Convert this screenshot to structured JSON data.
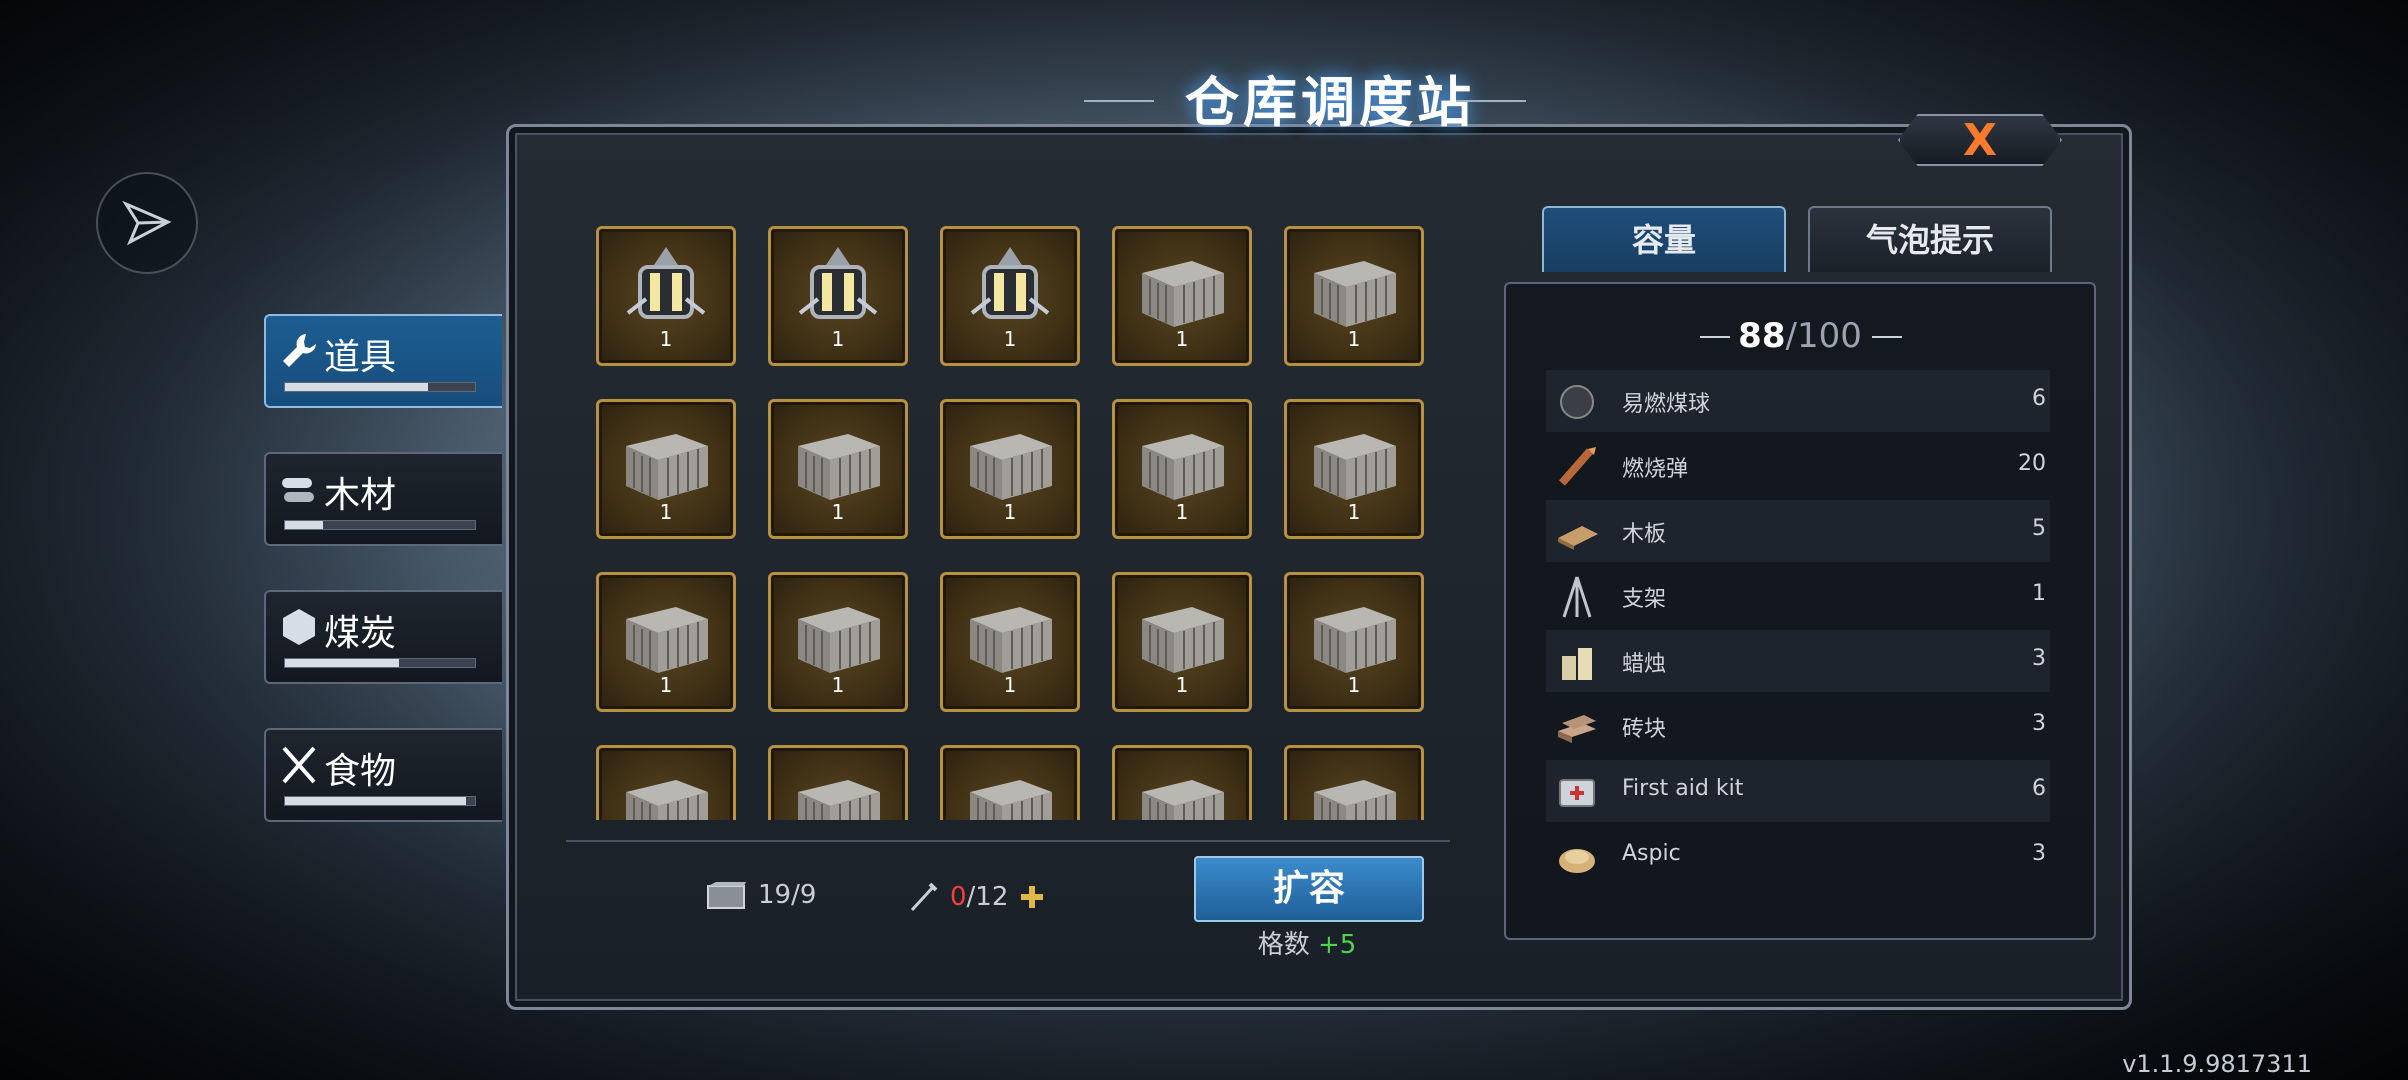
{
  "title": "仓库调度站",
  "close_label": "X",
  "sidebar": {
    "items": [
      {
        "label": "道具",
        "icon": "wrench-icon",
        "progress": 0.75,
        "active": true
      },
      {
        "label": "木材",
        "icon": "logs-icon",
        "progress": 0.2,
        "active": false
      },
      {
        "label": "煤炭",
        "icon": "coal-icon",
        "progress": 0.6,
        "active": false
      },
      {
        "label": "食物",
        "icon": "utensils-icon",
        "progress": 0.95,
        "active": false
      }
    ]
  },
  "grid": {
    "slots": [
      {
        "type": "lantern",
        "qty": "1"
      },
      {
        "type": "lantern",
        "qty": "1"
      },
      {
        "type": "lantern",
        "qty": "1"
      },
      {
        "type": "crate",
        "qty": "1"
      },
      {
        "type": "crate",
        "qty": "1"
      },
      {
        "type": "crate",
        "qty": "1"
      },
      {
        "type": "crate",
        "qty": "1"
      },
      {
        "type": "crate",
        "qty": "1"
      },
      {
        "type": "crate",
        "qty": "1"
      },
      {
        "type": "crate",
        "qty": "1"
      },
      {
        "type": "crate",
        "qty": "1"
      },
      {
        "type": "crate",
        "qty": "1"
      },
      {
        "type": "crate",
        "qty": "1"
      },
      {
        "type": "crate",
        "qty": "1"
      },
      {
        "type": "crate",
        "qty": "1"
      },
      {
        "type": "crate",
        "qty": ""
      },
      {
        "type": "crate",
        "qty": ""
      },
      {
        "type": "crate",
        "qty": ""
      },
      {
        "type": "crate",
        "qty": ""
      },
      {
        "type": "crate",
        "qty": ""
      }
    ]
  },
  "footer": {
    "crate_stat": "19/9",
    "nail_current": "0",
    "nail_total": "/12",
    "expand_label": "扩容",
    "slots_label": "格数",
    "slots_bonus": "+5"
  },
  "tabs": [
    {
      "label": "容量",
      "active": true
    },
    {
      "label": "气泡提示",
      "active": false
    }
  ],
  "capacity": {
    "current": "88",
    "max": "/100"
  },
  "resources": [
    {
      "name": "易燃煤球",
      "count": "6",
      "icon": "coal-ball-icon"
    },
    {
      "name": "燃烧弹",
      "count": "20",
      "icon": "firebomb-icon"
    },
    {
      "name": "木板",
      "count": "5",
      "icon": "plank-icon"
    },
    {
      "name": "支架",
      "count": "1",
      "icon": "tripod-icon"
    },
    {
      "name": "蜡烛",
      "count": "3",
      "icon": "candle-icon"
    },
    {
      "name": "砖块",
      "count": "3",
      "icon": "brick-icon"
    },
    {
      "name": "First aid kit",
      "count": "6",
      "icon": "first-aid-kit-icon"
    },
    {
      "name": "Aspic",
      "count": "3",
      "icon": "aspic-icon"
    }
  ],
  "version": "v1.1.9.9817311",
  "colors": {
    "accent_blue": "#1f5f98",
    "slot_gold": "#b8913e",
    "close_orange": "#ff7a2c",
    "bonus_green": "#4fd34f",
    "warn_red": "#ff3b3b"
  }
}
